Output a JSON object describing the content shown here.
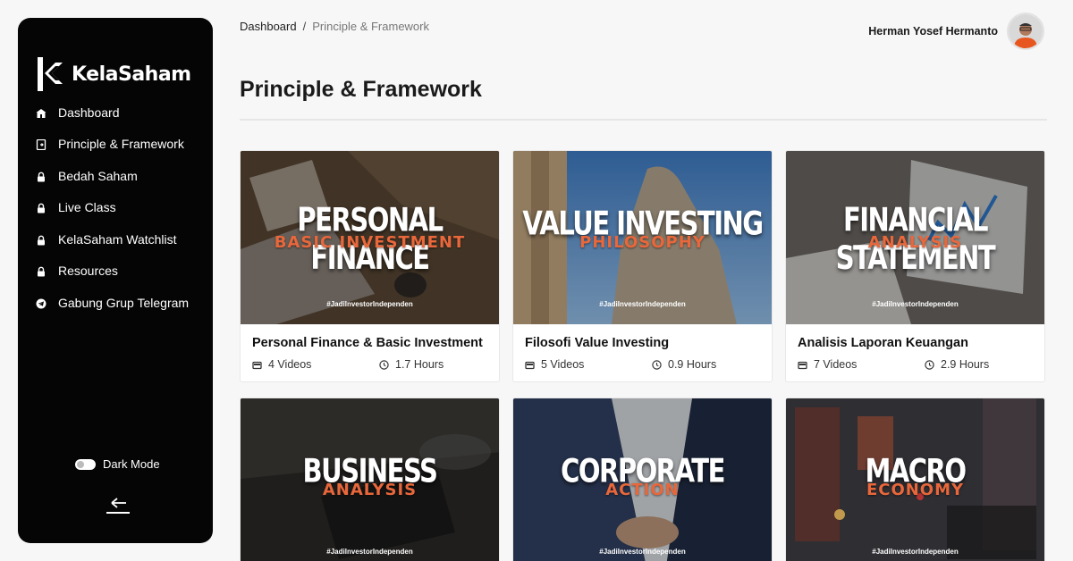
{
  "app": {
    "name": "KelaSaham"
  },
  "sidebar": {
    "items": [
      {
        "label": "Dashboard",
        "icon": "home-icon"
      },
      {
        "label": "Principle & Framework",
        "icon": "document-icon"
      },
      {
        "label": "Bedah Saham",
        "icon": "lock-icon"
      },
      {
        "label": "Live Class",
        "icon": "lock-icon"
      },
      {
        "label": "KelaSaham Watchlist",
        "icon": "lock-icon"
      },
      {
        "label": "Resources",
        "icon": "lock-icon"
      },
      {
        "label": "Gabung Grup Telegram",
        "icon": "telegram-icon"
      }
    ],
    "dark_mode_label": "Dark Mode",
    "collapse_icon": "arrow-left-icon"
  },
  "breadcrumb": {
    "root": "Dashboard",
    "separator": "/",
    "current": "Principle & Framework"
  },
  "user": {
    "name": "Herman Yosef Hermanto"
  },
  "page": {
    "title": "Principle & Framework"
  },
  "courses": [
    {
      "thumb_line1": "PERSONAL FINANCE",
      "thumb_line2": "BASIC INVESTMENT",
      "hashtag": "#JadiInvestorIndependen",
      "title": "Personal Finance & Basic Investment",
      "videos": "4 Videos",
      "hours": "1.7 Hours"
    },
    {
      "thumb_line1": "VALUE INVESTING",
      "thumb_line2": "PHILOSOPHY",
      "hashtag": "#JadiInvestorIndependen",
      "title": "Filosofi Value Investing",
      "videos": "5 Videos",
      "hours": "0.9 Hours"
    },
    {
      "thumb_line1": "FINANCIAL STATEMENT",
      "thumb_line2": "ANALYSIS",
      "hashtag": "#JadiInvestorIndependen",
      "title": "Analisis Laporan Keuangan",
      "videos": "7 Videos",
      "hours": "2.9 Hours"
    },
    {
      "thumb_line1": "BUSINESS",
      "thumb_line2": "ANALYSIS",
      "hashtag": "#JadiInvestorIndependen"
    },
    {
      "thumb_line1": "CORPORATE",
      "thumb_line2": "ACTION",
      "hashtag": "#JadiInvestorIndependen"
    },
    {
      "thumb_line1": "MACRO",
      "thumb_line2": "ECONOMY",
      "hashtag": "#JadiInvestorIndependen"
    }
  ],
  "colors": {
    "sidebar_bg": "#050505",
    "accent_orange": "#e8673b",
    "page_bg": "#f7f7f7"
  }
}
